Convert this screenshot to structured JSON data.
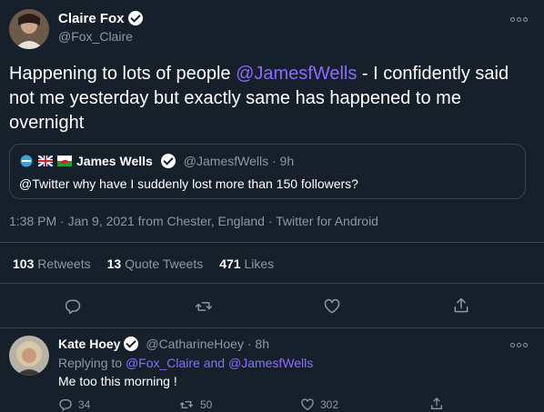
{
  "main_tweet": {
    "author_name": "Claire Fox",
    "handle": "@Fox_Claire",
    "text_before": "Happening to lots of people ",
    "mention": "@JamesfWells",
    "text_after": " - I confidently said not me yesterday but exactly same has happened to me overnight",
    "timestamp": "1:38 PM · Jan 9, 2021 from Chester, England",
    "client": "Twitter for Android",
    "retweets_count": "103",
    "retweets_label": "Retweets",
    "quotes_count": "13",
    "quotes_label": "Quote Tweets",
    "likes_count": "471",
    "likes_label": "Likes"
  },
  "quoted_tweet": {
    "author_name": "James Wells",
    "handle_time": "@JamesfWells · 9h",
    "text": "@Twitter why have I suddenly lost more than 150 followers?"
  },
  "reply_tweet": {
    "author_name": "Kate Hoey",
    "handle": "@CatharineHoey",
    "time": "· 8h",
    "replying_prefix": "Replying to ",
    "replying_to": "@Fox_Claire and @JamesfWells",
    "text": "Me too this morning !",
    "reply_count": "34",
    "retweet_count": "50",
    "like_count": "302"
  },
  "colors": {
    "background": "#15202b",
    "link": "#8c6bff",
    "muted": "#8899a6",
    "divider": "#38444d"
  },
  "icons": [
    "verified-badge-icon",
    "more-options-icon",
    "reply-icon",
    "retweet-icon",
    "like-icon",
    "share-icon",
    "emoji-icons"
  ]
}
